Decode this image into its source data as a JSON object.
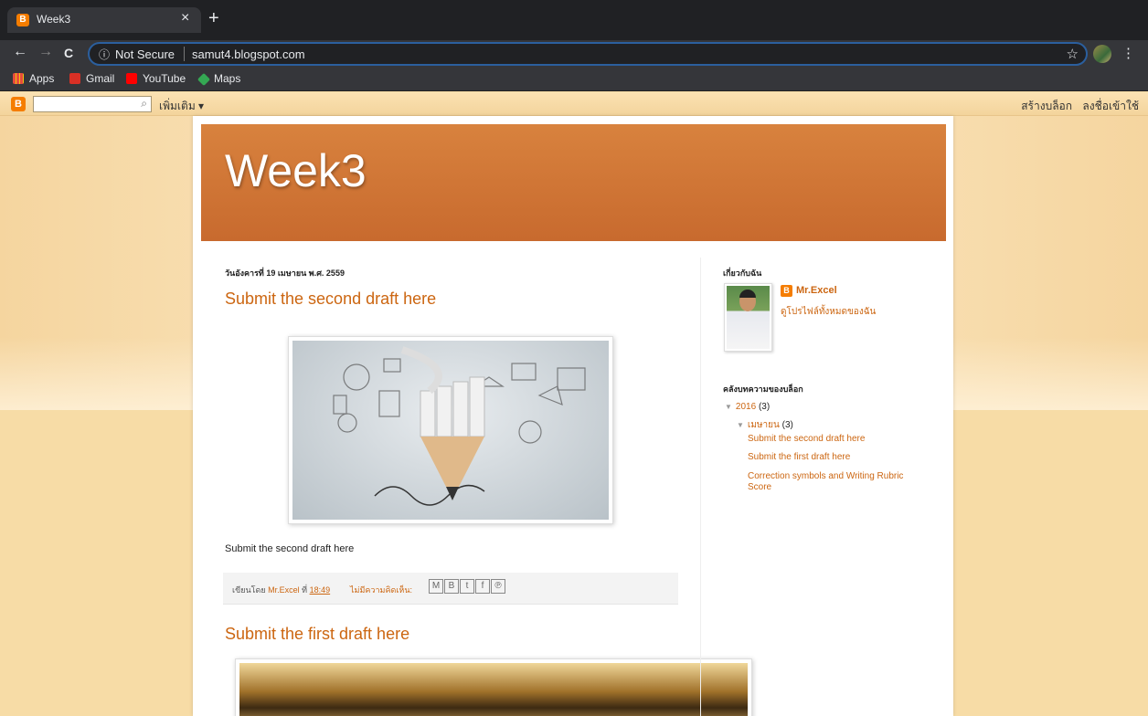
{
  "browser": {
    "tab_title": "Week3",
    "tab_close": "×",
    "new_tab": "+",
    "back": "←",
    "forward": "→",
    "reload": "C",
    "info_icon": "ⓘ",
    "security_label": "Not Secure",
    "url": "samut4.blogspot.com",
    "star": "☆",
    "menu": "⋮",
    "bookmarks": [
      "Apps",
      "Gmail",
      "YouTube",
      "Maps"
    ]
  },
  "navbar": {
    "logo": "B",
    "search_icon": "🔍",
    "more_label": "เพิ่มเติม ▾",
    "create_blog": "สร้างบล็อก",
    "sign_in": "ลงชื่อเข้าใช้"
  },
  "blog": {
    "title": "Week3",
    "date_header": "วันอังคารที่ 19 เมษายน พ.ศ. 2559",
    "posts": [
      {
        "title": "Submit the second draft here",
        "body": "Submit the second draft here",
        "posted_by_label": "เขียนโดย",
        "author": "Mr.Excel",
        "at_label": "ที่",
        "time": "18:49",
        "comments": "ไม่มีความคิดเห็น:",
        "share_icons": [
          "M",
          "B",
          "t",
          "f",
          "℗"
        ]
      },
      {
        "title": "Submit the first draft here"
      }
    ]
  },
  "sidebar": {
    "about_heading": "เกี่ยวกับฉัน",
    "profile_badge": "B",
    "profile_name": "Mr.Excel",
    "profile_link": "ดูโปรไฟล์ทั้งหมดของฉัน",
    "archive_heading": "คลังบทความของบล็อก",
    "year": "2016",
    "year_count": "(3)",
    "month": "เมษายน",
    "month_count": "(3)",
    "toggle": "▼",
    "archive_posts": [
      "Submit the second draft here",
      "Submit the first draft here",
      "Correction symbols and Writing Rubric Score"
    ]
  }
}
